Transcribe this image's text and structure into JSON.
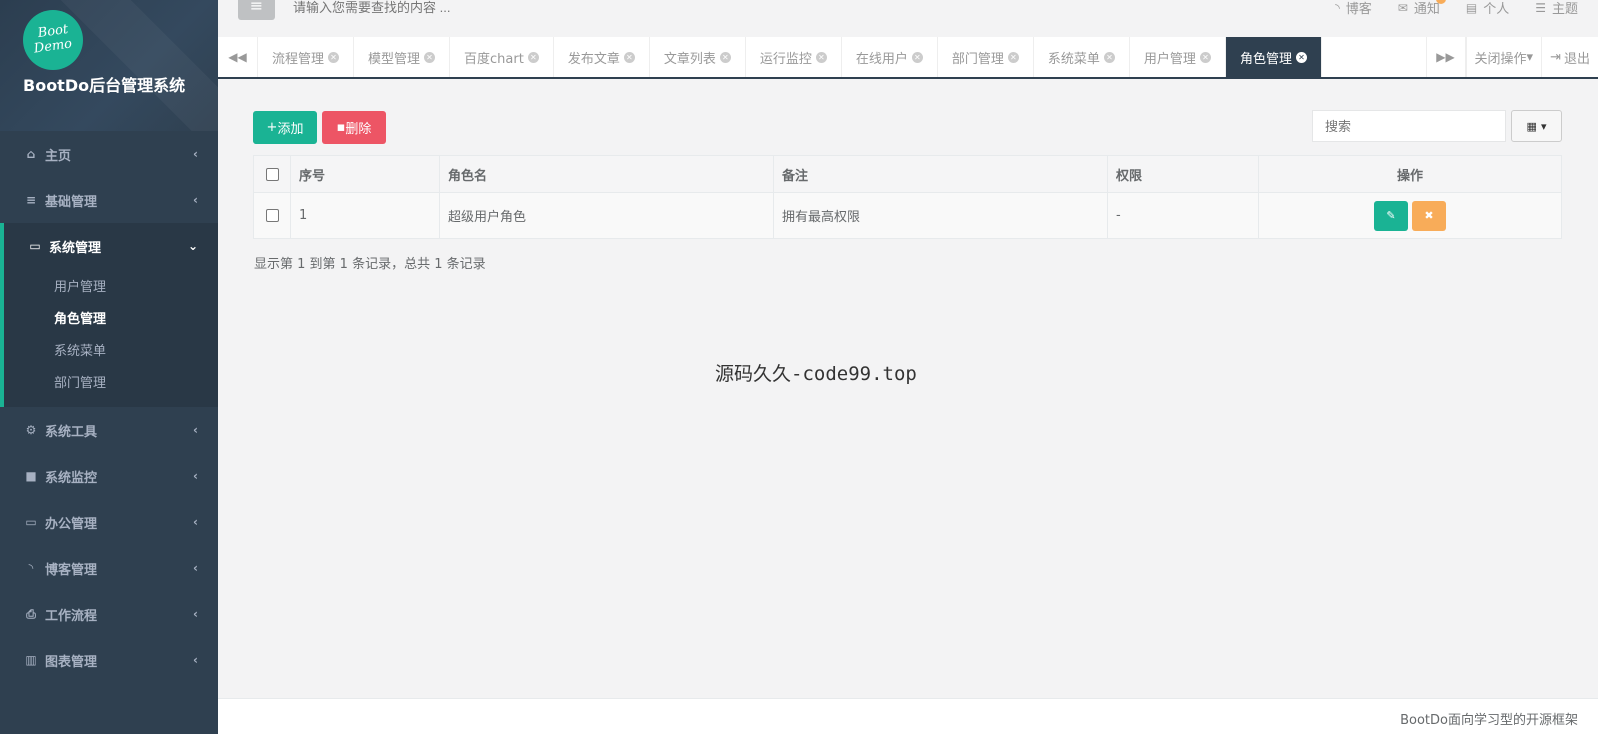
{
  "sidebar": {
    "logo_line1": "Boot",
    "logo_line2": "Demo",
    "brand": "BootDo后台管理系统",
    "items": [
      {
        "label": "主页",
        "icon": "home-icon"
      },
      {
        "label": "基础管理",
        "icon": "list-icon"
      },
      {
        "label": "系统管理",
        "icon": "desktop-icon",
        "expanded": true
      },
      {
        "label": "系统工具",
        "icon": "gear-icon"
      },
      {
        "label": "系统监控",
        "icon": "video-icon"
      },
      {
        "label": "办公管理",
        "icon": "laptop-icon"
      },
      {
        "label": "博客管理",
        "icon": "rss-icon"
      },
      {
        "label": "工作流程",
        "icon": "print-icon"
      },
      {
        "label": "图表管理",
        "icon": "bar-chart-icon"
      }
    ],
    "sub_items": [
      "用户管理",
      "角色管理",
      "系统菜单",
      "部门管理"
    ],
    "active_sub": "角色管理"
  },
  "topbar": {
    "search_placeholder": "请输入您需要查找的内容 ...",
    "links": [
      "博客",
      "通知",
      "个人",
      "主题"
    ]
  },
  "tabs": {
    "items": [
      "流程管理",
      "模型管理",
      "百度chart",
      "发布文章",
      "文章列表",
      "运行监控",
      "在线用户",
      "部门管理",
      "系统菜单",
      "用户管理",
      "角色管理"
    ],
    "active": "角色管理",
    "close_ops": "关闭操作",
    "exit": "退出"
  },
  "toolbar": {
    "add_label": "添加",
    "delete_label": "删除",
    "search_placeholder": "搜索"
  },
  "table": {
    "headers": [
      "序号",
      "角色名",
      "备注",
      "权限",
      "操作"
    ],
    "rows": [
      {
        "no": "1",
        "name": "超级用户角色",
        "note": "拥有最高权限",
        "perm": "-"
      }
    ]
  },
  "pagination_text": "显示第 1 到第 1 条记录，总共 1 条记录",
  "watermark": "源码久久-code99.top",
  "footer": "BootDo面向学习型的开源框架",
  "colors": {
    "primary": "#1ab394",
    "danger": "#ed5565",
    "warning": "#f8ac59",
    "sidebar": "#2f4050"
  }
}
